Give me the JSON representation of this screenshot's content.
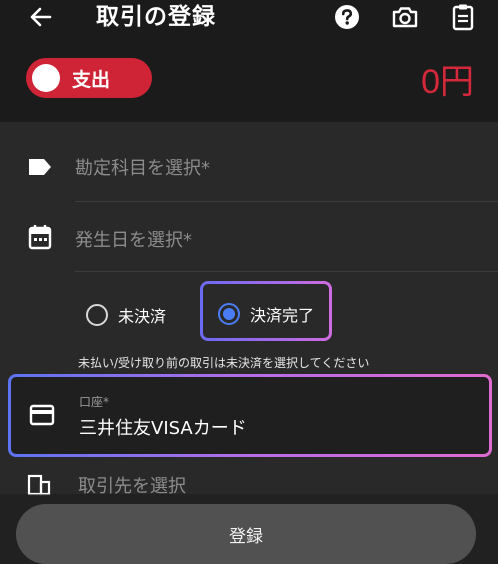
{
  "header": {
    "title": "取引の登録",
    "back_icon": "arrow-left-icon",
    "actions": [
      "help-icon",
      "camera-icon",
      "clipboard-icon"
    ]
  },
  "transaction": {
    "type_label": "支出",
    "amount": "0円"
  },
  "form": {
    "category_placeholder": "勘定科目を選択*",
    "date_placeholder": "発生日を選択*",
    "status_options": [
      "未決済",
      "決済完了"
    ],
    "status_selected": "決済完了",
    "status_help": "未払い/受け取り前の取引は未決済を選択してください",
    "account_label": "口座*",
    "account_value": "三井住友VISAカード",
    "partner_placeholder": "取引先を選択"
  },
  "submit_label": "登録",
  "colors": {
    "accent_red": "#cf2436",
    "accent_blue": "#4a7cf5",
    "highlight_gradient": [
      "#5b74f2",
      "#de6bd0"
    ]
  }
}
